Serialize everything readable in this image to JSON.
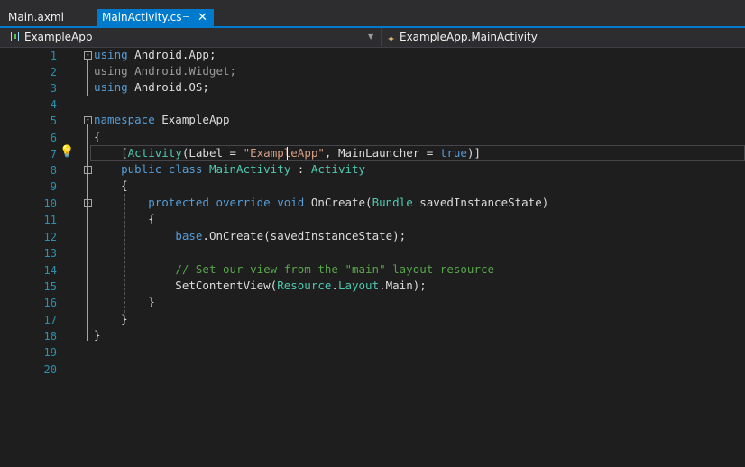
{
  "tabs": [
    {
      "label": "Main.axml"
    },
    {
      "label": "MainActivity.cs",
      "pin": "⊣",
      "close": "✕"
    }
  ],
  "nav": {
    "project": "ExampleApp",
    "member": "ExampleApp.MainActivity"
  },
  "lines": [
    "1",
    "2",
    "3",
    "4",
    "5",
    "6",
    "7",
    "8",
    "9",
    "10",
    "11",
    "12",
    "13",
    "14",
    "15",
    "16",
    "17",
    "18",
    "19",
    "20"
  ],
  "code": {
    "l1_kw": "using",
    "l1_rest": " Android.App;",
    "l2": "using Android.Widget;",
    "l3_kw": "using",
    "l3_rest": " Android.OS;",
    "l5_kw": "namespace",
    "l5_rest": " ExampleApp",
    "l6": "{",
    "l7_a": "    [",
    "l7_attr": "Activity",
    "l7_b": "(Label = ",
    "l7_str": "\"ExampleApp\"",
    "l7_c": ", MainLauncher = ",
    "l7_true": "true",
    "l7_d": ")]",
    "l8_a": "    ",
    "l8_kw": "public class",
    "l8_sp": " ",
    "l8_name": "MainActivity",
    "l8_colon": " : ",
    "l8_base": "Activity",
    "l9": "    {",
    "l10_a": "        ",
    "l10_kw": "protected override void",
    "l10_b": " OnCreate(",
    "l10_ty": "Bundle",
    "l10_c": " savedInstanceState)",
    "l11": "        {",
    "l12_a": "            ",
    "l12_kw": "base",
    "l12_b": ".OnCreate(savedInstanceState);",
    "l14_a": "            ",
    "l14_cm": "// Set our view from the \"main\" layout resource",
    "l15_a": "            SetContentView(",
    "l15_ty1": "Resource",
    "l15_dot1": ".",
    "l15_ty2": "Layout",
    "l15_b": ".Main);",
    "l16": "        }",
    "l17": "    }",
    "l18": "}"
  },
  "colors": {
    "accent": "#007acc",
    "keyword": "#569cd6",
    "type": "#4ec9b0",
    "string": "#d69d85",
    "comment": "#57a64a",
    "line_number": "#2b91af"
  }
}
